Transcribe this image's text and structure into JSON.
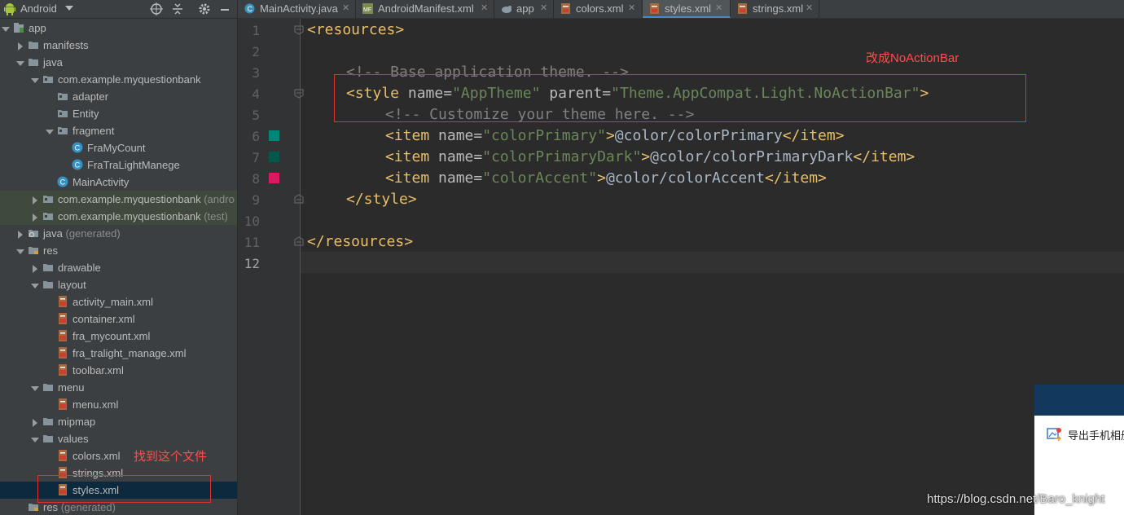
{
  "project_panel": {
    "view_label": "Android",
    "tree": [
      {
        "label": "app",
        "dim": ""
      },
      {
        "label": "manifests",
        "dim": ""
      },
      {
        "label": "java",
        "dim": ""
      },
      {
        "label": "com.example.myquestionbank",
        "dim": ""
      },
      {
        "label": "adapter",
        "dim": ""
      },
      {
        "label": "Entity",
        "dim": ""
      },
      {
        "label": "fragment",
        "dim": ""
      },
      {
        "label": "FraMyCount",
        "dim": ""
      },
      {
        "label": "FraTraLightManege",
        "dim": ""
      },
      {
        "label": "MainActivity",
        "dim": ""
      },
      {
        "label": "com.example.myquestionbank",
        "dim": "(andro"
      },
      {
        "label": "com.example.myquestionbank",
        "dim": "(test)"
      },
      {
        "label": "java",
        "dim": "(generated)"
      },
      {
        "label": "res",
        "dim": ""
      },
      {
        "label": "drawable",
        "dim": ""
      },
      {
        "label": "layout",
        "dim": ""
      },
      {
        "label": "activity_main.xml",
        "dim": ""
      },
      {
        "label": "container.xml",
        "dim": ""
      },
      {
        "label": "fra_mycount.xml",
        "dim": ""
      },
      {
        "label": "fra_tralight_manage.xml",
        "dim": ""
      },
      {
        "label": "toolbar.xml",
        "dim": ""
      },
      {
        "label": "menu",
        "dim": ""
      },
      {
        "label": "menu.xml",
        "dim": ""
      },
      {
        "label": "mipmap",
        "dim": ""
      },
      {
        "label": "values",
        "dim": ""
      },
      {
        "label": "colors.xml",
        "dim": ""
      },
      {
        "label": "strings.xml",
        "dim": ""
      },
      {
        "label": "styles.xml",
        "dim": ""
      },
      {
        "label": "res",
        "dim": "(generated)"
      }
    ]
  },
  "tabs": [
    {
      "label": "MainActivity.java",
      "close": "✕"
    },
    {
      "label": "AndroidManifest.xml",
      "close": "✕"
    },
    {
      "label": "app",
      "close": "✕"
    },
    {
      "label": "colors.xml",
      "close": "✕"
    },
    {
      "label": "styles.xml",
      "close": "✕"
    },
    {
      "label": "strings.xml",
      "close": "✕"
    }
  ],
  "editor": {
    "line_numbers": [
      "1",
      "2",
      "3",
      "4",
      "5",
      "6",
      "7",
      "8",
      "9",
      "10",
      "11",
      "12"
    ],
    "lines": {
      "l1": {
        "open": "<resources>"
      },
      "l3": {
        "comment": "<!-- Base application theme. -->"
      },
      "l4": {
        "open": "<style",
        "a1": " name=",
        "v1": "\"AppTheme\"",
        "a2": " parent=",
        "v2": "\"Theme.AppCompat.Light.NoActionBar\"",
        "close": ">"
      },
      "l5": {
        "comment": "<!-- Customize your theme here. -->"
      },
      "l6": {
        "open": "<item",
        "a1": " name=",
        "v1": "\"colorPrimary\"",
        "close": ">",
        "text": "@color/colorPrimary",
        "end": "</item>"
      },
      "l7": {
        "open": "<item",
        "a1": " name=",
        "v1": "\"colorPrimaryDark\"",
        "close": ">",
        "text": "@color/colorPrimaryDark",
        "end": "</item>"
      },
      "l8": {
        "open": "<item",
        "a1": " name=",
        "v1": "\"colorAccent\"",
        "close": ">",
        "text": "@color/colorAccent",
        "end": "</item>"
      },
      "l9": {
        "end": "</style>"
      },
      "l11": {
        "end": "</resources>"
      }
    },
    "swatch_colors": [
      "#008577",
      "#00574B",
      "#D81B60"
    ]
  },
  "annotations": {
    "top": "改成NoActionBar",
    "side": "找到这个文件"
  },
  "popup": {
    "text": "导出手机相册"
  },
  "watermark": "https://blog.csdn.net/Baro_knight"
}
